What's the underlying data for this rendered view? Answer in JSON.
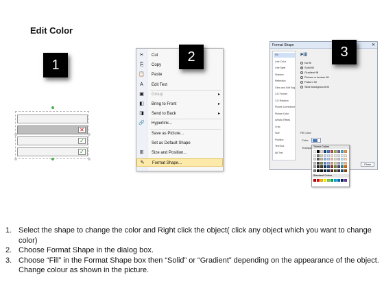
{
  "title": "Edit Color",
  "badges": [
    "1",
    "2",
    "3"
  ],
  "context_menu": {
    "items": [
      {
        "label": "Cut",
        "icon": "scissors-icon",
        "glyph": "✂",
        "disabled": false,
        "submenu": false
      },
      {
        "label": "Copy",
        "icon": "copy-icon",
        "glyph": "⎘",
        "disabled": false,
        "submenu": false
      },
      {
        "label": "Paste",
        "icon": "paste-icon",
        "glyph": "📋",
        "disabled": false,
        "submenu": false
      },
      {
        "label": "Edit Text",
        "icon": "edit-text-icon",
        "glyph": "A",
        "disabled": false,
        "submenu": false
      },
      {
        "label": "Group",
        "icon": "group-icon",
        "glyph": "▣",
        "disabled": true,
        "submenu": true
      },
      {
        "label": "Bring to Front",
        "icon": "bring-to-front-icon",
        "glyph": "◧",
        "disabled": false,
        "submenu": true
      },
      {
        "label": "Send to Back",
        "icon": "send-to-back-icon",
        "glyph": "◨",
        "disabled": false,
        "submenu": true
      },
      {
        "label": "Hyperlink...",
        "icon": "hyperlink-icon",
        "glyph": "🔗",
        "disabled": false,
        "submenu": false
      },
      {
        "label": "Save as Picture...",
        "icon": "",
        "glyph": "",
        "disabled": false,
        "submenu": false
      },
      {
        "label": "Set as Default Shape",
        "icon": "",
        "glyph": "",
        "disabled": false,
        "submenu": false
      },
      {
        "label": "Size and Position...",
        "icon": "size-position-icon",
        "glyph": "⊞",
        "disabled": false,
        "submenu": false
      },
      {
        "label": "Format Shape...",
        "icon": "format-shape-icon",
        "glyph": "✎",
        "disabled": false,
        "submenu": false,
        "highlighted": true
      }
    ]
  },
  "dialog": {
    "title": "Format Shape",
    "nav": [
      "Fill",
      "Line Color",
      "Line Style",
      "Shadow",
      "Reflection",
      "Glow and Soft Edges",
      "3-D Format",
      "3-D Rotation",
      "Picture Corrections",
      "Picture Color",
      "Artistic Effects",
      "Crop",
      "Size",
      "Position",
      "Text Box",
      "Alt Text"
    ],
    "pane_title": "Fill",
    "options": [
      "No fill",
      "Solid fill",
      "Gradient fill",
      "Picture or texture fill",
      "Pattern fill",
      "Slide background fill"
    ],
    "selected_option": "Solid fill",
    "fill_color_label": "Fill Color",
    "color_label": "Color:",
    "transparency_label": "Transpa",
    "theme_colors_label": "Theme Colors",
    "standard_colors_label": "Standard Colors",
    "close_label": "Close"
  },
  "colors": {
    "theme_top": [
      "#ffffff",
      "#000000",
      "#eeece1",
      "#1f497d",
      "#4f81bd",
      "#c0504d",
      "#9bbb59",
      "#8064a2",
      "#4bacc6",
      "#f79646"
    ],
    "theme_shades": [
      [
        "#f2f2f2",
        "#7f7f7f",
        "#ddd9c3",
        "#c6d9f0",
        "#dbe5f1",
        "#f2dcdb",
        "#ebf1dd",
        "#e5e0ec",
        "#dbeef3",
        "#fdeada"
      ],
      [
        "#d8d8d8",
        "#595959",
        "#c4bd97",
        "#8db3e2",
        "#b8cce4",
        "#e5b9b7",
        "#d7e3bc",
        "#ccc1d9",
        "#b7dde8",
        "#fbd5b5"
      ],
      [
        "#bfbfbf",
        "#3f3f3f",
        "#938953",
        "#548dd4",
        "#95b3d7",
        "#d99694",
        "#c3d69b",
        "#b2a2c7",
        "#92cddc",
        "#fac08f"
      ],
      [
        "#a5a5a5",
        "#262626",
        "#494429",
        "#17365d",
        "#366092",
        "#953734",
        "#76923c",
        "#5f497a",
        "#31859b",
        "#e36c09"
      ],
      [
        "#7f7f7f",
        "#0c0c0c",
        "#1d1b10",
        "#0f243e",
        "#244061",
        "#632423",
        "#4f6128",
        "#3f3151",
        "#205867",
        "#974806"
      ]
    ],
    "standard": [
      "#c00000",
      "#ff0000",
      "#ffc000",
      "#ffff00",
      "#92d050",
      "#00b050",
      "#00b0f0",
      "#0070c0",
      "#002060",
      "#7030a0"
    ]
  },
  "steps": [
    {
      "num": "1.",
      "text": "Select the shape to change the color and Right click the object( click any object which you want to change color)"
    },
    {
      "num": "2.",
      "text": "Choose Format Shape in the dialog box."
    },
    {
      "num": "3.",
      "text": "Choose “Fill” in the Format Shape box then “Solid” or “Gradient” depending on the appearance of the object. Change colour as shown in the picture."
    }
  ]
}
